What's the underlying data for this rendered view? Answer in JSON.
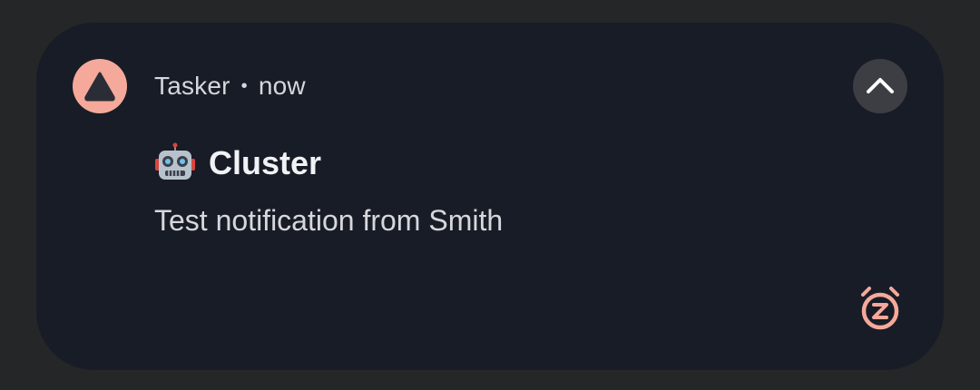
{
  "notification": {
    "app_name": "Tasker",
    "separator": "•",
    "time": "now",
    "title": "Cluster",
    "title_icon": "robot-face-icon",
    "body": "Test notification from Smith",
    "app_icon": "triangle-icon",
    "expand_icon": "chevron-up-icon",
    "snooze_icon": "alarm-snooze-icon"
  },
  "colors": {
    "background": "#252628",
    "card": "#181c26",
    "app_icon_bg": "#f5a99b",
    "app_icon_glyph": "#2a2d36",
    "expand_bg": "#3c3e44",
    "snooze": "#f5a99b",
    "text_primary": "#f1f2f5",
    "text_secondary": "#d6d7dc"
  }
}
